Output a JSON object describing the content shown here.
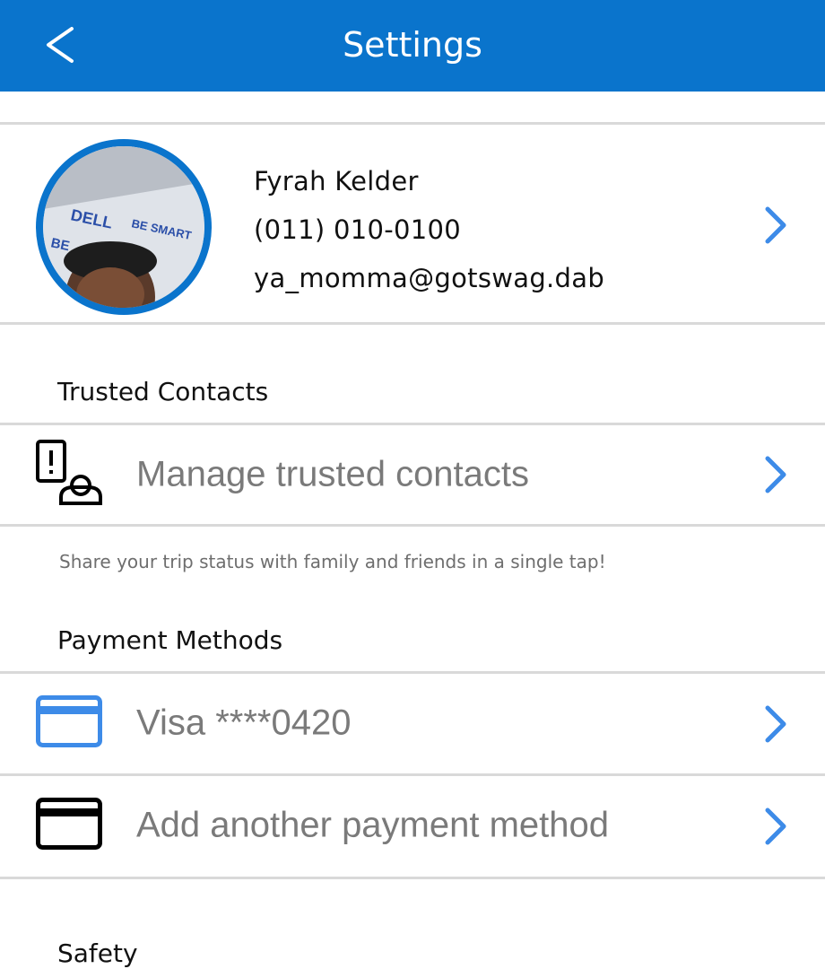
{
  "header": {
    "title": "Settings",
    "back_icon": "chevron-left-icon",
    "color": "#0a74cc"
  },
  "profile": {
    "name": "Fyrah Kelder",
    "phone": "(011) 010-0100",
    "email": "ya_momma@gotswag.dab",
    "avatar_text": [
      "DELL",
      "BE SMART",
      "BE"
    ],
    "chevron_color": "#3d8be8"
  },
  "trusted_contacts": {
    "section_label": "Trusted Contacts",
    "manage_label": "Manage trusted contacts",
    "manage_icon": "phone-alert-contact-icon",
    "hint": "Share your trip status with family and friends in a single tap!"
  },
  "payment_methods": {
    "section_label": "Payment Methods",
    "items": [
      {
        "label": "Visa ****0420",
        "icon": "credit-card-icon",
        "icon_color": "#3d8be8"
      },
      {
        "label": "Add another payment method",
        "icon": "credit-card-icon",
        "icon_color": "#000000"
      }
    ]
  },
  "safety": {
    "section_label": "Safety"
  }
}
